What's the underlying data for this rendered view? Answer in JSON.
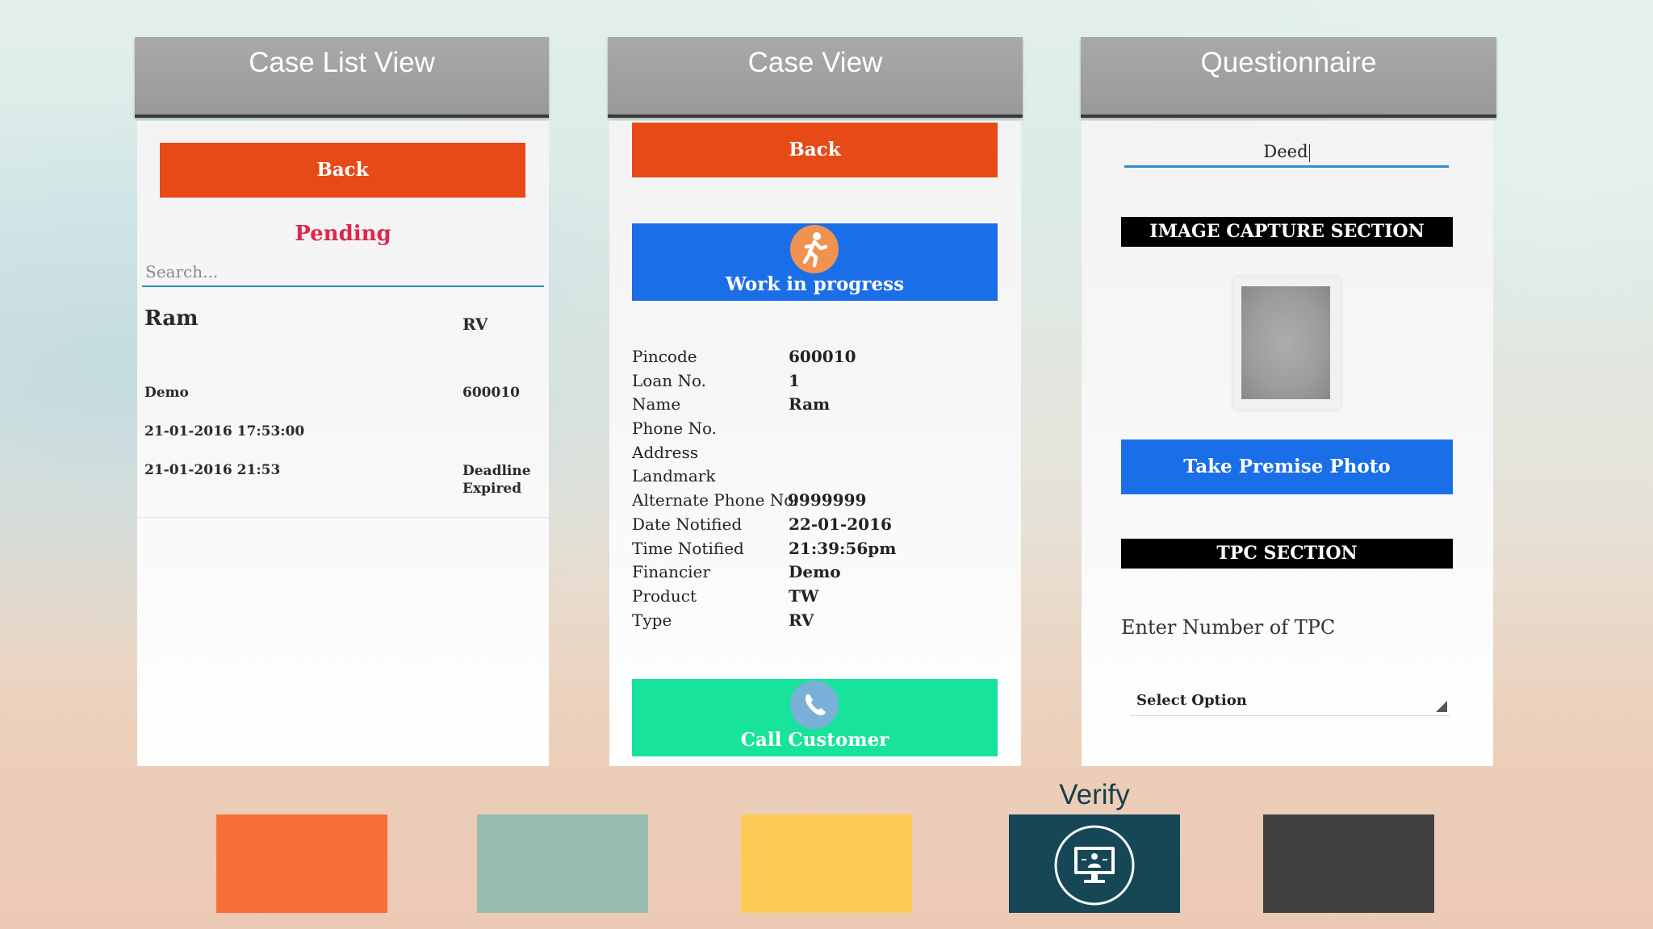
{
  "panels": {
    "case_list": {
      "title": "Case List View",
      "back_label": "Back",
      "status_heading": "Pending",
      "search_placeholder": "Search...",
      "item": {
        "name": "Ram",
        "type": "RV",
        "financier": "Demo",
        "pincode": "600010",
        "notified": "21-01-2016 17:53:00",
        "deadline": "21-01-2016 21:53",
        "deadline_status": "Deadline Expired"
      }
    },
    "case_view": {
      "title": "Case View",
      "back_label": "Back",
      "status_label": "Work in progress",
      "call_label": "Call Customer",
      "details": [
        {
          "key": "Pincode",
          "value": "600010"
        },
        {
          "key": "Loan No.",
          "value": "1"
        },
        {
          "key": "Name",
          "value": "Ram"
        },
        {
          "key": "Phone No.",
          "value": ""
        },
        {
          "key": "Address",
          "value": ""
        },
        {
          "key": "Landmark",
          "value": ""
        },
        {
          "key": "Alternate Phone No.",
          "value": "9999999"
        },
        {
          "key": "Date Notified",
          "value": "22-01-2016"
        },
        {
          "key": "Time Notified",
          "value": "21:39:56pm"
        },
        {
          "key": "Financier",
          "value": "Demo"
        },
        {
          "key": "Product",
          "value": "TW"
        },
        {
          "key": "Type",
          "value": "RV"
        }
      ]
    },
    "questionnaire": {
      "title": "Questionnaire",
      "document_value": "Deed",
      "image_section_label": "IMAGE CAPTURE SECTION",
      "take_photo_label": "Take Premise Photo",
      "tpc_section_label": "TPC SECTION",
      "tpc_prompt": "Enter Number of TPC",
      "select_value": "Select Option"
    }
  },
  "bottom_tiles": {
    "verify_label": "Verify",
    "colors": [
      "#f76e36",
      "#96bcad",
      "#fecb57",
      "#154757",
      "#414141"
    ]
  },
  "icons": {
    "work_in_progress": "running-person-icon",
    "call": "phone-icon",
    "verify": "monitor-user-icon"
  }
}
